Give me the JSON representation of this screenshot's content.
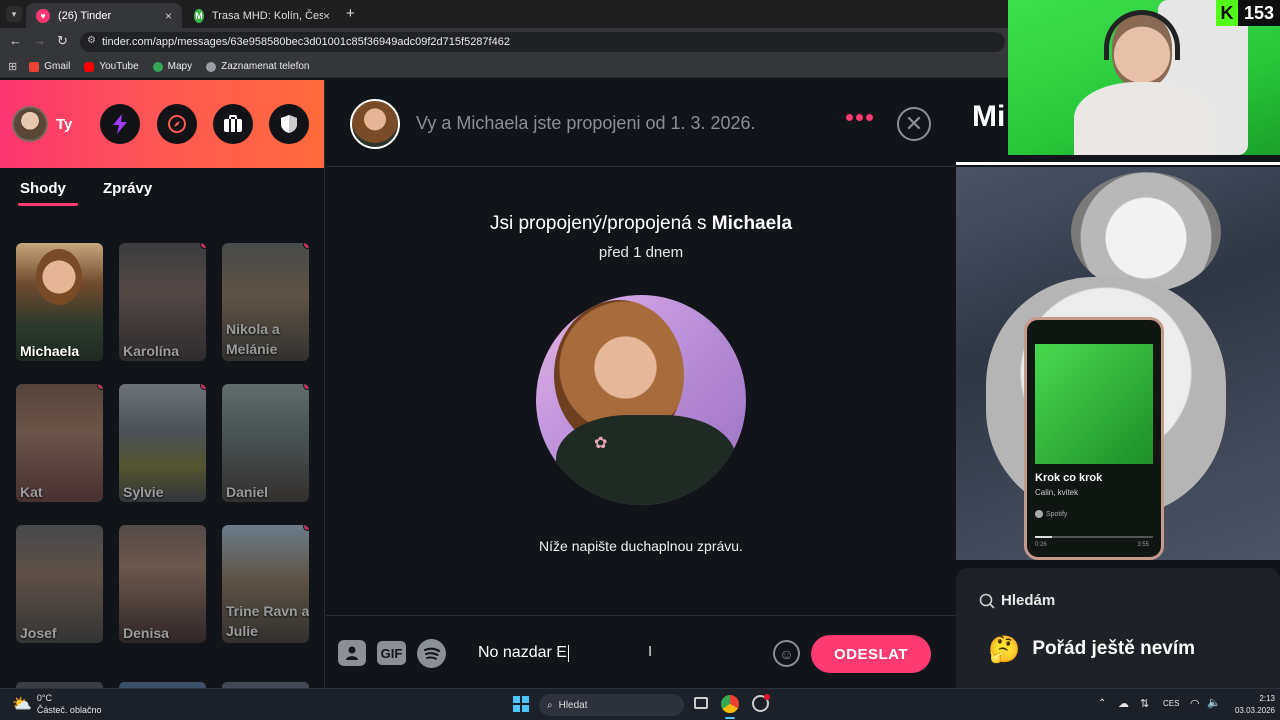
{
  "browser": {
    "tabs": [
      {
        "title": "(26) Tinder",
        "active": true,
        "close": "×"
      },
      {
        "title": "Trasa MHD: Kolín, Česko ⇒ Pro",
        "active": false,
        "close": "×"
      }
    ],
    "new_tab": "+",
    "url": "tinder.com/app/messages/63e958580bec3d01001c85f36949adc09f2d715f5287f462",
    "bookmarks": [
      "Gmail",
      "YouTube",
      "Mapy",
      "Zaznamenat telefon"
    ]
  },
  "sidebar": {
    "user_label": "Ty",
    "tabs": [
      {
        "label": "Shody",
        "active": true
      },
      {
        "label": "Zprávy",
        "active": false
      }
    ],
    "matches": [
      {
        "name": "Michaela",
        "new": false
      },
      {
        "name": "Karolína",
        "new": true
      },
      {
        "name": "Nikola a Melánie",
        "new": true
      },
      {
        "name": "Kat",
        "new": true
      },
      {
        "name": "Sylvie",
        "new": true
      },
      {
        "name": "Daniel",
        "new": true
      },
      {
        "name": "Josef",
        "new": false
      },
      {
        "name": "Denisa",
        "new": false
      },
      {
        "name": "Trine Ravn a Julie",
        "new": true
      }
    ]
  },
  "chat": {
    "header_text": "Vy a Michaela jste propojeni od 1. 3. 2026.",
    "match_prefix": "Jsi propojený/propojená s ",
    "match_name": "Michaela",
    "match_time": "před 1 dnem",
    "prompt": "Níže napište duchaplnou zprávu.",
    "input_value": "No nazdar E",
    "gif_label": "GIF",
    "send_label": "ODESLAT"
  },
  "profile": {
    "name_partial": "Mi",
    "spotify_song": "Krok co krok",
    "spotify_artist": "Calin, kvitek",
    "spotify_brand": "Spotify",
    "spotify_time_start": "0:26",
    "spotify_time_end": "3:55",
    "looking_for_label": "Hledám",
    "looking_for_emoji": "🤔",
    "looking_for_value": "Pořád ještě nevím"
  },
  "stream_overlay": {
    "badge_letter": "K",
    "badge_count": "153"
  },
  "taskbar": {
    "weather_temp": "0°C",
    "weather_desc": "Částeč. oblačno",
    "search_placeholder": "Hledat",
    "lang": "CES",
    "time": "2:13",
    "date": "03.03.2026"
  },
  "colors": {
    "tinder_gradient_start": "#fd3572",
    "tinder_gradient_end": "#ff6a3d",
    "accent": "#fd3b72",
    "background": "#111418"
  }
}
